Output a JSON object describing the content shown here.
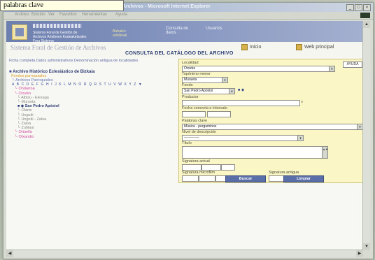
{
  "tooltip": {
    "text": "palabras clave"
  },
  "window": {
    "title": "Archivos - Microsoft Internet Explorer"
  },
  "menu": [
    "Archivo",
    "Edición",
    "Ver",
    "Favoritos",
    "Herramientas",
    "Ayuda"
  ],
  "banner": {
    "system_name": "Sistema Foral de Gestión de Archivos Artxiboen Kudeaketarako Foru Sistema",
    "tab_a": "Bizkaiko artxiboak",
    "tab_b": "Consulta de datos",
    "tab_c": "Usuarios"
  },
  "header": {
    "site_name": "Sistema Foral de Gestión de Archivos",
    "link_inicio": "Inicio",
    "link_principal": "Web principal",
    "page_title": "CONSULTA DEL CATÁLOGO DEL ARCHIVO"
  },
  "left": {
    "views": "Ficha completa  Datos administrativos  Denominación antigua de localidades",
    "root": "Archivo Histórico Eclesiástico de Bizkaia",
    "fondos": "Fondos parroquiales",
    "parroquias": "Archivos Parroquiales",
    "alphabet": "A B C D E F G H I J K L M N O R Q R S T U V W X Y Z",
    "items": [
      "Ondarroa",
      "Orozko",
      "Albisu - Elexaga",
      "Murueta",
      "San Pedro Apóstol",
      "Olarte",
      "Ungoiti",
      "Ungoiti - Zaloa",
      "Zaloa",
      "Zubiaur",
      "Ortuella",
      "Otxandio"
    ]
  },
  "form": {
    "help": "AYUDA",
    "localidad_label": "Localidad",
    "localidad_value": "Orozko",
    "toponimo_label": "Topónimo menor",
    "toponimo_value": "Murueta",
    "fondo_label": "Fondo",
    "fondo_value": "San Pedro Apóstol",
    "productor_label": "Productor",
    "fecha_label": "Fecha concreta o intervalo",
    "palabras_label": "Palabras clave",
    "palabras_value": "Música - pergaminos",
    "nivel_label": "Nivel de descripción",
    "nivel_value": "-------------",
    "titulo_label": "Título",
    "sig_actual_label": "Signatura actual",
    "sig_micro_label": "Signatura microfilm",
    "sig_antigua_label": "Signatura antigua",
    "buscar": "Buscar",
    "limpiar": "Limpiar"
  },
  "colors": {
    "accent": "#5a6ea8",
    "form_bg": "#fbf6c6",
    "banner": "#7f8fb9"
  }
}
